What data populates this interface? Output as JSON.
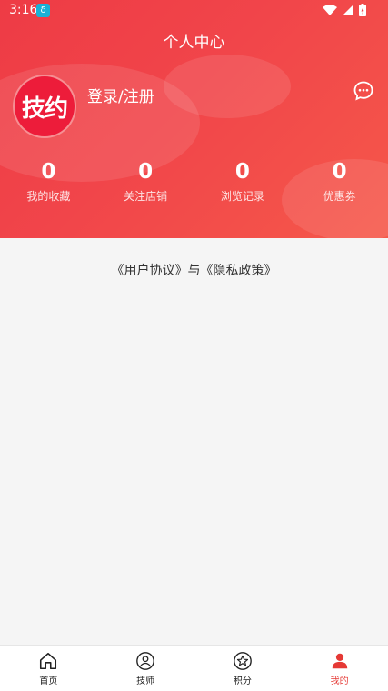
{
  "status": {
    "time": "3:16",
    "badge": "δ"
  },
  "header": {
    "title": "个人中心"
  },
  "profile": {
    "avatar_text": "技约",
    "login_label": "登录/注册"
  },
  "stats": [
    {
      "value": "0",
      "label": "我的收藏"
    },
    {
      "value": "0",
      "label": "关注店铺"
    },
    {
      "value": "0",
      "label": "浏览记录"
    },
    {
      "value": "0",
      "label": "优惠券"
    }
  ],
  "agreement": {
    "user": "《用户协议》",
    "and": "与",
    "privacy": "《隐私政策》"
  },
  "tabs": [
    {
      "label": "首页",
      "icon": "home-icon"
    },
    {
      "label": "技师",
      "icon": "technician-icon"
    },
    {
      "label": "积分",
      "icon": "points-icon"
    },
    {
      "label": "我的",
      "icon": "profile-icon",
      "active": true
    }
  ],
  "colors": {
    "accent": "#ee3b45",
    "active_tab": "#e53935"
  }
}
